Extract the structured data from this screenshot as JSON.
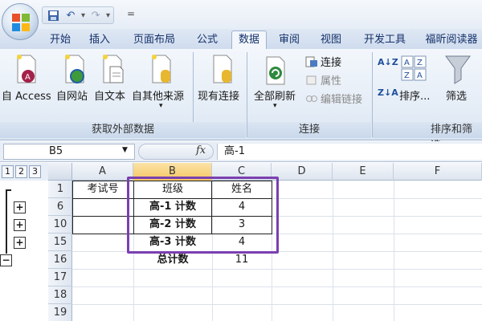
{
  "quick_access": {
    "undo_icon": "undo-icon",
    "redo_icon": "redo-icon",
    "save_icon": "save-icon",
    "customize": "="
  },
  "tabs": [
    "开始",
    "插入",
    "页面布局",
    "公式",
    "数据",
    "审阅",
    "视图",
    "开发工具",
    "福昕阅读器"
  ],
  "active_tab": "数据",
  "ribbon": {
    "groups": {
      "external_data": "获取外部数据",
      "connections": "连接",
      "sort_filter": "排序和筛选"
    },
    "buttons": {
      "access": "自 Access",
      "web": "自网站",
      "text": "自文本",
      "other": "自其他来源",
      "existing": "现有连接",
      "refresh_all": "全部刷新",
      "connections": "连接",
      "properties": "属性",
      "edit_links": "编辑链接",
      "sort": "排序...",
      "filter": "筛选"
    }
  },
  "formula_bar": {
    "name_box": "B5",
    "fx": "fx",
    "content": "高-1"
  },
  "outline": {
    "levels": [
      "1",
      "2",
      "3"
    ],
    "plus": "+",
    "minus": "−"
  },
  "columns": [
    "A",
    "B",
    "C",
    "D",
    "E",
    "F"
  ],
  "rows": [
    "1",
    "6",
    "10",
    "15",
    "16",
    "17",
    "18",
    "19"
  ],
  "cells": {
    "a1": "考试号",
    "b1": "班级",
    "c1": "姓名",
    "b6": "高-1 计数",
    "c6": "4",
    "b10": "高-2 计数",
    "c10": "3",
    "b15": "高-3 计数",
    "c15": "4",
    "b16": "总计数",
    "c16": "11"
  },
  "colors": {
    "highlight_box": "#7a3fb0",
    "selected_header": "#f5c561"
  }
}
